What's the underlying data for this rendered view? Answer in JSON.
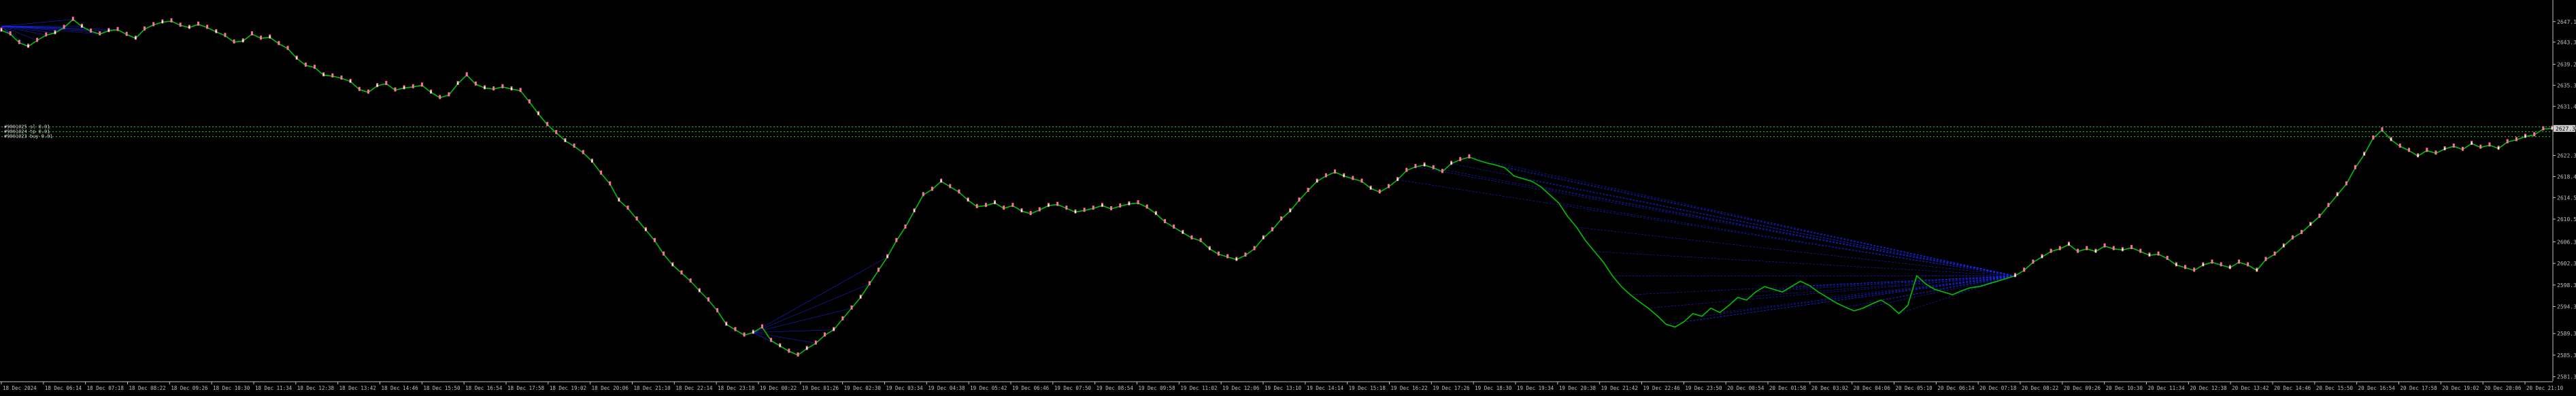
{
  "colors": {
    "background": "#000000",
    "axis": "#bfbfbf",
    "price_line": "#00c000",
    "bull_candle": "#ff6f9f",
    "fan_lines": "#1a2bff",
    "dotted_levels": "#2fd22f",
    "level_text": "#d9d9d9",
    "current_price_box": "#d0d0d0"
  },
  "y_axis": {
    "min": 2580.5,
    "max": 2650.6,
    "ticks": [
      "2647.1",
      "2643.3",
      "2639.2",
      "2635.3",
      "2631.4",
      "2627.5",
      "2622.3",
      "2618.4",
      "2614.5",
      "2610.5",
      "2606.3",
      "2602.3",
      "2598.3",
      "2594.3",
      "2589.3",
      "2585.3",
      "2581.3"
    ]
  },
  "current_price": "2627.3",
  "time_axis": {
    "ticks": [
      "18 Dec 2024",
      "18 Dec 06:14",
      "18 Dec 07:18",
      "18 Dec 08:22",
      "18 Dec 09:26",
      "18 Dec 10:30",
      "18 Dec 11:34",
      "18 Dec 12:38",
      "18 Dec 13:42",
      "18 Dec 14:46",
      "18 Dec 15:50",
      "18 Dec 16:54",
      "18 Dec 17:58",
      "18 Dec 19:02",
      "18 Dec 20:06",
      "18 Dec 21:10",
      "18 Dec 22:14",
      "18 Dec 23:18",
      "19 Dec 00:22",
      "19 Dec 01:26",
      "19 Dec 02:30",
      "19 Dec 03:34",
      "19 Dec 04:38",
      "19 Dec 05:42",
      "19 Dec 06:46",
      "19 Dec 07:50",
      "19 Dec 08:54",
      "19 Dec 09:58",
      "19 Dec 11:02",
      "19 Dec 12:06",
      "19 Dec 13:10",
      "19 Dec 14:14",
      "19 Dec 15:18",
      "19 Dec 16:22",
      "19 Dec 17:26",
      "19 Dec 18:30",
      "19 Dec 19:34",
      "19 Dec 20:38",
      "19 Dec 21:42",
      "19 Dec 22:46",
      "19 Dec 23:50",
      "20 Dec 00:54",
      "20 Dec 01:58",
      "20 Dec 03:02",
      "20 Dec 04:06",
      "20 Dec 05:10",
      "20 Dec 06:14",
      "20 Dec 07:18",
      "20 Dec 08:22",
      "20 Dec 09:26",
      "20 Dec 10:30",
      "20 Dec 11:34",
      "20 Dec 12:38",
      "20 Dec 13:42",
      "20 Dec 14:46",
      "20 Dec 15:50",
      "20 Dec 16:54",
      "20 Dec 17:58",
      "20 Dec 19:02",
      "20 Dec 20:06",
      "20 Dec 21:10"
    ]
  },
  "level_labels": [
    "#9001025 sl 0.01",
    "#9001024 tp 0.01",
    "#9001023 buy 0.01"
  ],
  "chart_data": {
    "type": "line",
    "title": "",
    "xlabel": "",
    "ylabel": "",
    "ylim": [
      2580.5,
      2650.6
    ],
    "grid": false,
    "series": [
      {
        "values": [
          2645.5,
          2644.8,
          2643.2,
          2642.5,
          2643.6,
          2644.6,
          2645.0,
          2646.0,
          2647.5,
          2646.2,
          2645.3,
          2644.8,
          2645.4,
          2645.6,
          2644.7,
          2644.0,
          2645.7,
          2646.5,
          2647.0,
          2647.2,
          2646.4,
          2646.0,
          2646.6,
          2646.0,
          2645.2,
          2644.5,
          2643.3,
          2643.5,
          2644.8,
          2644.0,
          2644.2,
          2643.0,
          2642.1,
          2640.3,
          2639.0,
          2638.6,
          2637.2,
          2637.0,
          2636.6,
          2636.0,
          2634.5,
          2634.0,
          2635.2,
          2635.6,
          2634.4,
          2634.8,
          2635.0,
          2635.3,
          2634.0,
          2633.0,
          2633.5,
          2635.6,
          2637.2,
          2635.5,
          2634.8,
          2634.6,
          2635.0,
          2634.6,
          2634.3,
          2632.2,
          2630.0,
          2628.0,
          2626.5,
          2625.0,
          2624.0,
          2622.8,
          2621.2,
          2619.0,
          2617.0,
          2614.0,
          2612.5,
          2610.5,
          2608.5,
          2606.5,
          2604.0,
          2602.0,
          2600.5,
          2599.0,
          2597.2,
          2595.5,
          2593.5,
          2591.0,
          2590.0,
          2589.0,
          2589.5,
          2590.5,
          2588.0,
          2587.0,
          2586.0,
          2585.3,
          2586.5,
          2587.5,
          2589.0,
          2590.0,
          2592.0,
          2594.0,
          2596.0,
          2598.5,
          2601.0,
          2603.5,
          2606.5,
          2609.0,
          2612.0,
          2615.0,
          2616.0,
          2617.5,
          2616.5,
          2615.5,
          2614.0,
          2612.8,
          2613.0,
          2613.5,
          2612.5,
          2613.0,
          2612.0,
          2611.5,
          2612.2,
          2613.0,
          2613.2,
          2612.5,
          2611.8,
          2612.1,
          2612.5,
          2613.0,
          2612.4,
          2612.9,
          2613.3,
          2613.5,
          2612.7,
          2611.5,
          2610.0,
          2609.0,
          2608.0,
          2607.0,
          2606.5,
          2605.0,
          2604.0,
          2603.5,
          2603.0,
          2603.8,
          2605.0,
          2607.0,
          2608.5,
          2610.5,
          2612.0,
          2614.0,
          2615.8,
          2617.5,
          2618.5,
          2619.2,
          2618.5,
          2618.0,
          2617.5,
          2616.2,
          2615.5,
          2616.5,
          2617.8,
          2619.5,
          2620.2,
          2620.5,
          2620.0,
          2619.3,
          2620.8,
          2621.5,
          2622.0,
          2621.4,
          2620.9,
          2620.5,
          2620.0,
          2618.5,
          2618.0,
          2617.5,
          2616.5,
          2615.0,
          2613.5,
          2611.0,
          2609.0,
          2606.5,
          2604.5,
          2602.5,
          2600.0,
          2598.0,
          2596.5,
          2595.2,
          2594.0,
          2592.6,
          2591.0,
          2590.5,
          2591.5,
          2593.0,
          2592.5,
          2594.0,
          2593.2,
          2594.5,
          2596.0,
          2595.5,
          2597.0,
          2598.0,
          2597.5,
          2597.0,
          2598.0,
          2599.0,
          2598.2,
          2597.0,
          2596.0,
          2595.0,
          2594.2,
          2593.5,
          2594.0,
          2594.8,
          2595.5,
          2594.5,
          2593.0,
          2594.5,
          2600.0,
          2598.5,
          2597.5,
          2597.0,
          2596.5,
          2597.2,
          2597.8,
          2598.0,
          2598.5,
          2599.0,
          2599.5,
          2600.0,
          2601.0,
          2602.5,
          2603.5,
          2604.5,
          2605.0,
          2605.8,
          2604.5,
          2605.0,
          2604.5,
          2605.5,
          2605.0,
          2604.8,
          2605.2,
          2604.5,
          2603.8,
          2604.0,
          2603.2,
          2602.0,
          2601.5,
          2601.0,
          2602.0,
          2602.5,
          2602.0,
          2601.5,
          2602.5,
          2602.0,
          2601.0,
          2603.0,
          2604.0,
          2605.5,
          2607.0,
          2608.0,
          2609.5,
          2611.0,
          2613.0,
          2615.0,
          2617.0,
          2620.0,
          2622.5,
          2625.5,
          2627.0,
          2625.2,
          2624.0,
          2623.2,
          2622.2,
          2623.2,
          2622.7,
          2623.5,
          2624.0,
          2623.4,
          2624.5,
          2623.8,
          2624.2,
          2623.6,
          2624.8,
          2625.2,
          2625.8,
          2626.1,
          2627.2,
          2627.3
        ],
        "x_range": "18 Dec 2024 → 20 Dec 21:10"
      }
    ],
    "reference_levels": [
      2627.6,
      2626.7,
      2625.8
    ],
    "annotations": [
      "#9001025 sl 0.01",
      "#9001024 tp 0.01",
      "#9001023 buy 0.01"
    ]
  }
}
